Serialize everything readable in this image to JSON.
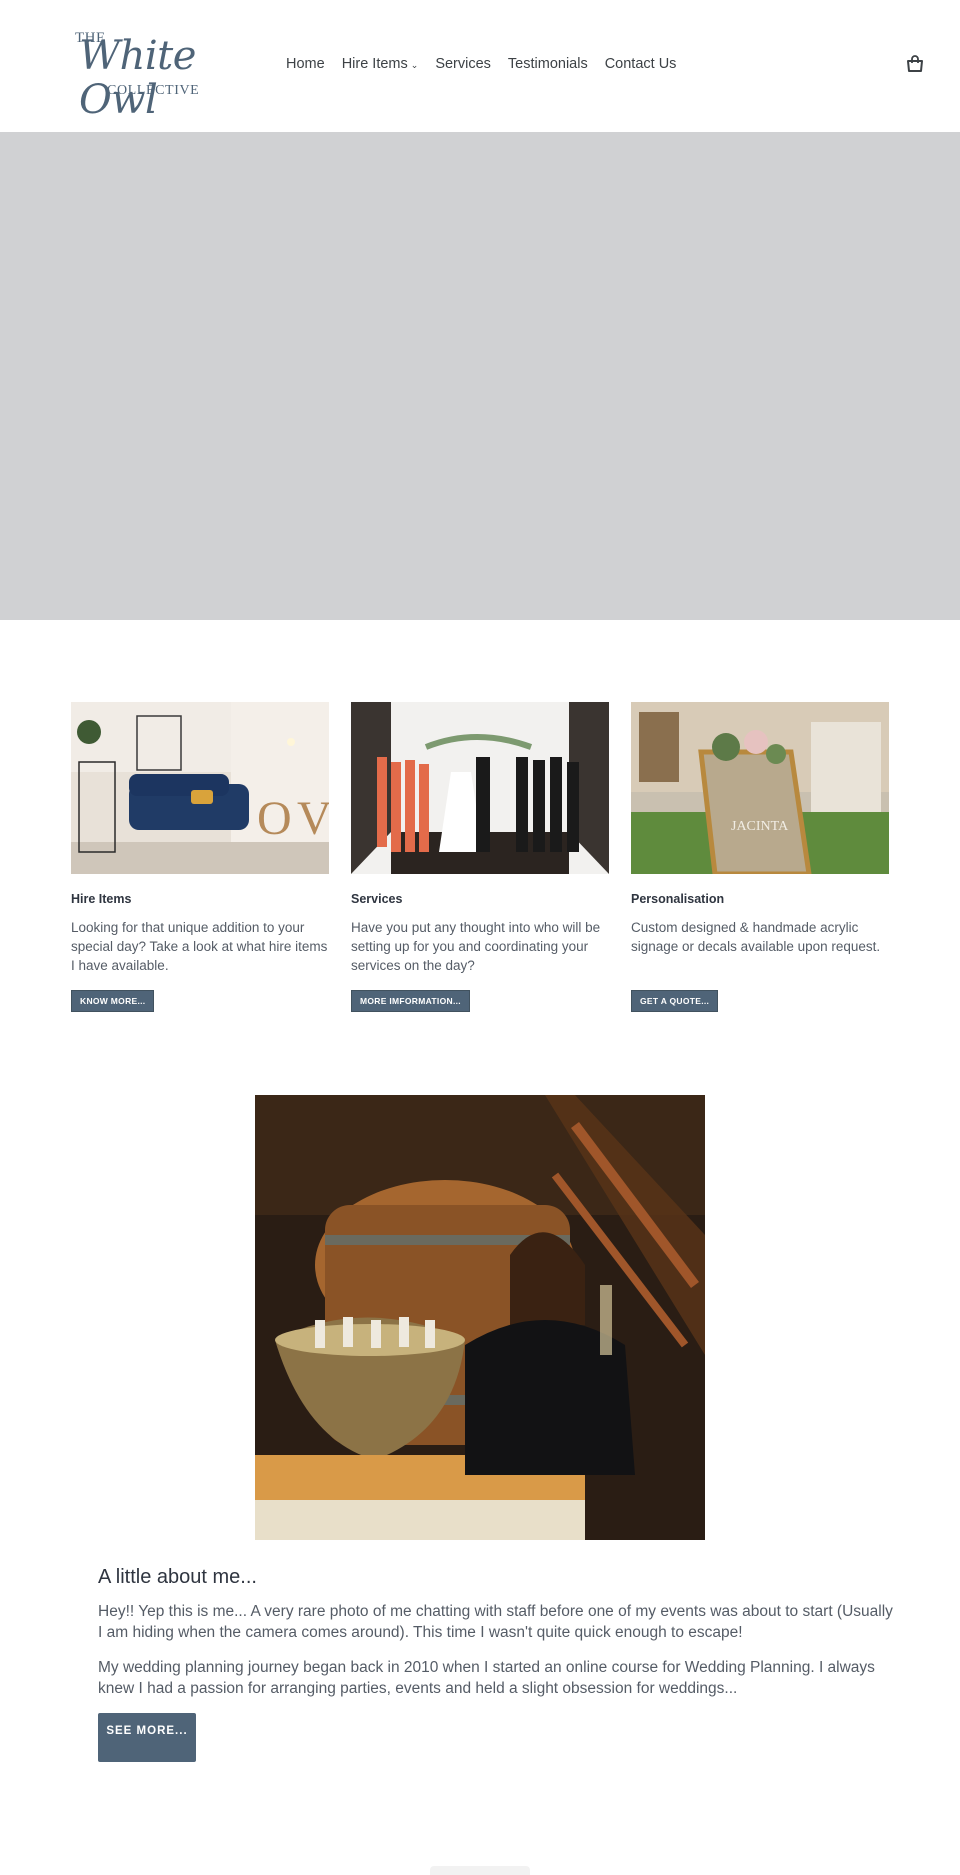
{
  "brand": {
    "line1": "THE",
    "line2": "White Owl",
    "line3": "COLLECTIVE"
  },
  "nav": {
    "items": [
      "Home",
      "Hire Items",
      "Services",
      "Testimonials",
      "Contact Us"
    ],
    "dropdown_chevron": "⌄",
    "cart_icon": "cart-icon"
  },
  "cards": [
    {
      "title": "Hire Items",
      "desc": "Looking for that unique addition to your special day? Take a look at what hire items I have available.",
      "button": "KNOW MORE..."
    },
    {
      "title": "Services",
      "desc": "Have you put any thought into who will be setting up for you and coordinating your services on the day?",
      "button": "MORE IMFORMATION..."
    },
    {
      "title": "Personalisation",
      "desc": "Custom designed & handmade acrylic signage or decals available upon request.",
      "button": "GET A QUOTE..."
    }
  ],
  "about": {
    "title": "A little about me...",
    "p1": "Hey!! Yep this is me... A very rare photo of me chatting with staff before one of my events was about to start (Usually I am hiding when the camera comes around). This time I wasn't quite quick enough to escape!",
    "p2": "My wedding planning journey began back in 2010 when I started an online course for Wedding Planning. I always knew I had a passion for arranging parties, events and held a slight obsession for weddings...",
    "button": "SEE MORE..."
  },
  "colors": {
    "accent": "#4f6478",
    "hero_placeholder": "#d0d1d3",
    "text": "#3d4246"
  }
}
